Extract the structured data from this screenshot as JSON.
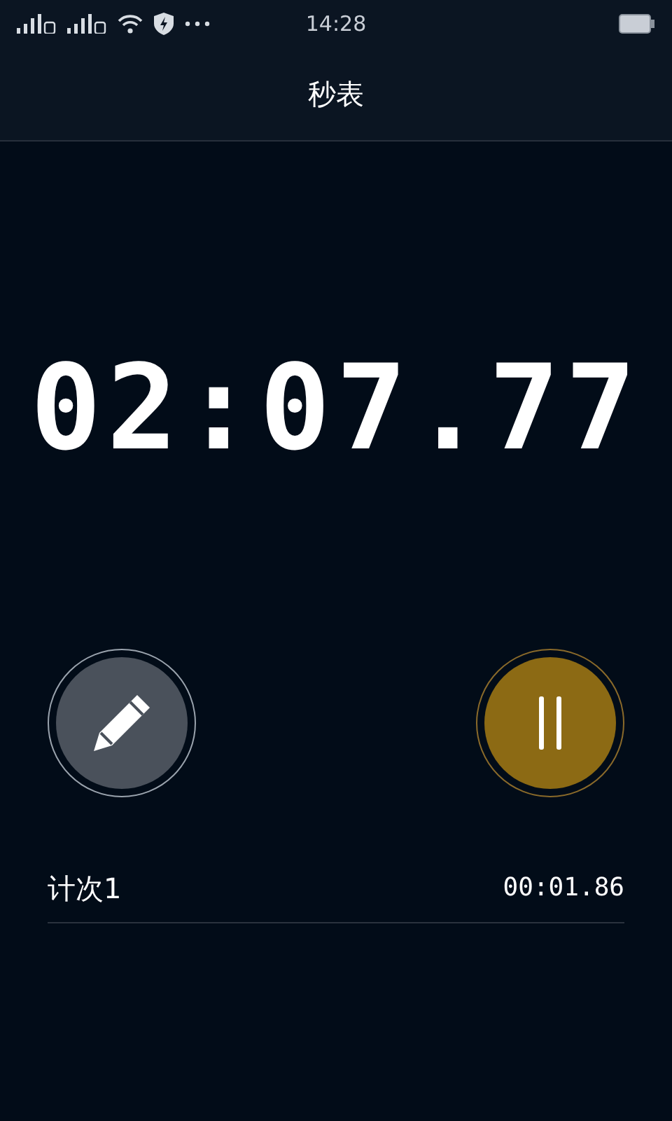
{
  "status_bar": {
    "time": "14:28"
  },
  "header": {
    "title": "秒表"
  },
  "timer": {
    "display": "02:07.77"
  },
  "controls": {
    "running": true
  },
  "laps": [
    {
      "label": "计次1",
      "time": "00:01.86"
    }
  ]
}
